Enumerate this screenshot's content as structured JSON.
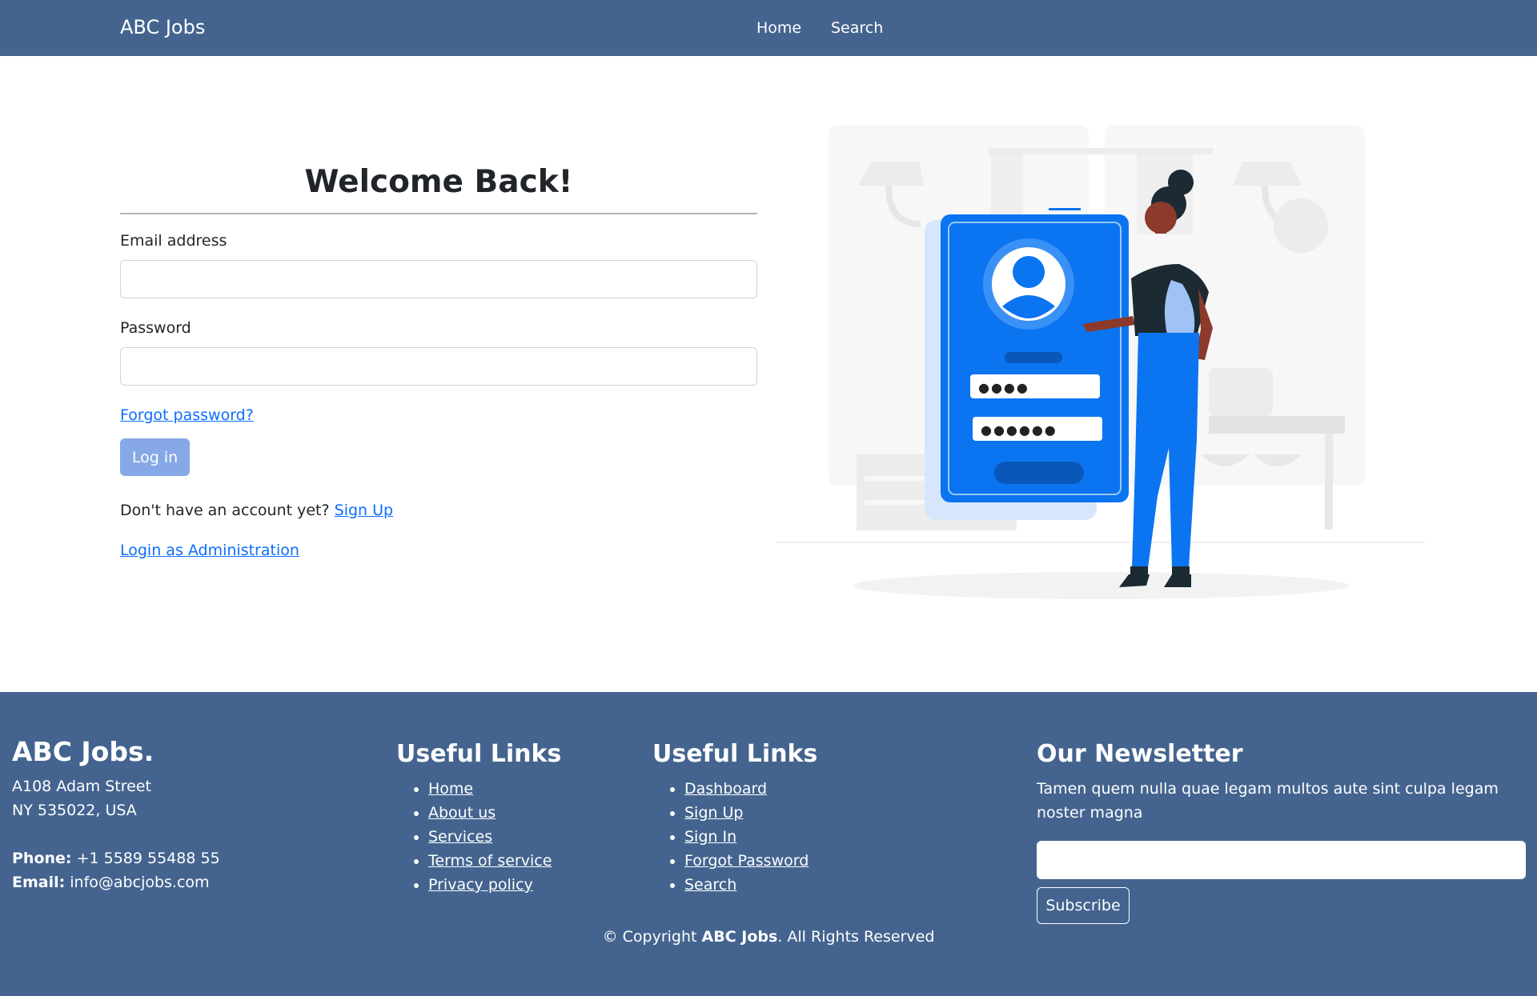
{
  "navbar": {
    "brand": "ABC Jobs",
    "links": [
      "Home",
      "Search"
    ]
  },
  "login": {
    "title": "Welcome Back!",
    "email_label": "Email address",
    "email_value": "",
    "password_label": "Password",
    "password_value": "",
    "forgot_link": "Forgot password?",
    "login_button": "Log in",
    "no_account_text": "Don't have an account yet?",
    "signup_link": "Sign Up",
    "admin_link": "Login as Administration"
  },
  "illustration": {
    "password_dots_1": "●●●●",
    "password_dots_2": "●●●●●●",
    "accent_color": "#0b74f0"
  },
  "footer": {
    "brand": "ABC Jobs.",
    "address_line1": "A108 Adam Street",
    "address_line2": "NY 535022, USA",
    "phone_label": "Phone:",
    "phone_value": "+1 5589 55488 55",
    "email_label": "Email:",
    "email_value": "info@abcjobs.com",
    "links1_heading": "Useful Links",
    "links1": [
      "Home",
      "About us",
      "Services",
      "Terms of service",
      "Privacy policy"
    ],
    "links2_heading": "Useful Links",
    "links2": [
      "Dashboard",
      "Sign Up",
      "Sign In",
      "Forgot Password",
      "Search"
    ],
    "newsletter_heading": "Our Newsletter",
    "newsletter_text": "Tamen quem nulla quae legam multos aute sint culpa legam noster magna",
    "newsletter_input_value": "",
    "subscribe_button": "Subscribe",
    "copyright_prefix": "© Copyright",
    "copyright_brand": "ABC Jobs",
    "copyright_suffix": ". All Rights Reserved"
  },
  "colors": {
    "navbar_bg": "#44648f",
    "footer_bg": "#44648f",
    "link": "#0d6efd",
    "login_button_bg": "#86a8e6"
  }
}
